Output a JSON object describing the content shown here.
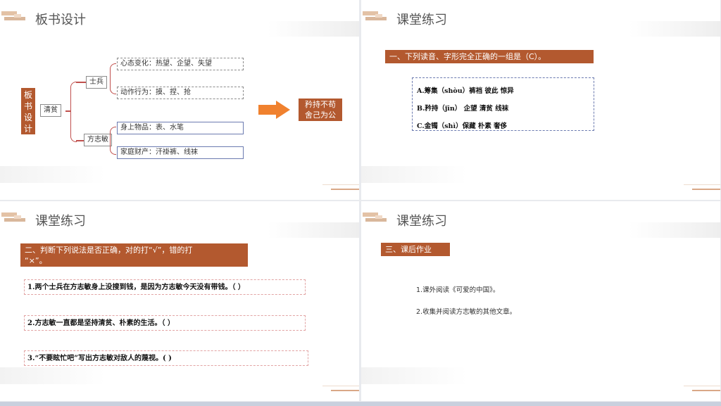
{
  "slide1": {
    "title": "板书设计",
    "vertical_label": [
      "板",
      "书",
      "设",
      "计"
    ],
    "center_label": "清贫",
    "soldier_label": "士兵",
    "fang_label": "方志敏",
    "items": [
      "心态变化：热望、企望、失望",
      "动作行为：摸、捏、抢",
      "身上物品：表、水笔",
      "家庭财产：汗褂裤、线袜"
    ],
    "result_lines": [
      "矜持不苟",
      "舍己为公"
    ],
    "accent_color": "#b3592f",
    "arrow_color": "#f0812e"
  },
  "slide2": {
    "title": "课堂练习",
    "question": "一、下列读音、字形完全正确的一组是（C）。",
    "options": [
      "A.筹集（shòu）裤裆 彼此 惊异",
      "B.矜持（jīn）    企望 清贫 线袜",
      "C.金镯（shì）保藏 朴素 奢侈"
    ]
  },
  "slide3": {
    "title": "课堂练习",
    "instruction_lines": [
      "二、判断下列说法是否正确，对的打“√”，错的打",
      "“×”。"
    ],
    "statements": [
      "1.两个士兵在方志敏身上没搜到钱，是因为方志敏今天没有带钱。（   ）",
      "2.方志敏一直都是坚持清贫、朴素的生活。（   ）",
      "3.“不要眩忙吧”写出方志敏对敌人的蔑视。(    )"
    ]
  },
  "slide4": {
    "title": "课堂练习",
    "heading": "三、课后作业",
    "items": [
      "1.课外阅读《可爱的中国》。",
      "2.收集并阅读方志敏的其他文章。"
    ]
  }
}
